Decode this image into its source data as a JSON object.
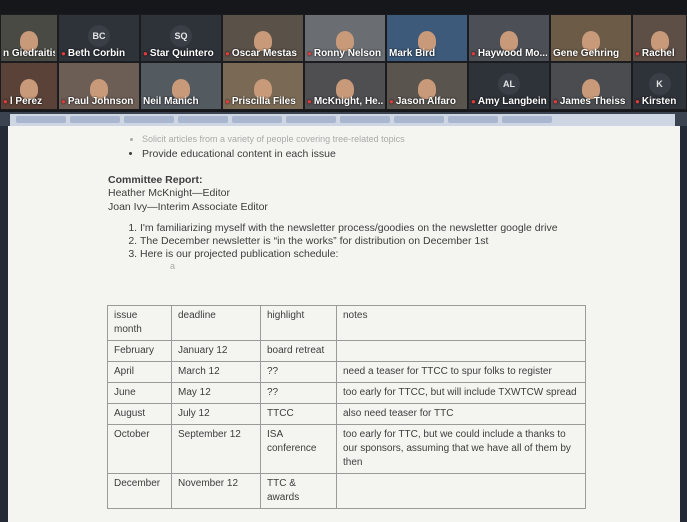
{
  "participants": [
    {
      "name": "n Giedraitis",
      "initials": "",
      "video": true,
      "muted": false
    },
    {
      "name": "Beth Corbin",
      "initials": "BC",
      "video": false,
      "muted": true
    },
    {
      "name": "Star Quintero",
      "initials": "SQ",
      "video": false,
      "muted": true
    },
    {
      "name": "Oscar Mestas",
      "initials": "",
      "video": true,
      "muted": true
    },
    {
      "name": "Ronny Nelson",
      "initials": "",
      "video": true,
      "muted": true
    },
    {
      "name": "Mark Bird",
      "initials": "",
      "video": true,
      "muted": false
    },
    {
      "name": "Haywood Mo...",
      "initials": "",
      "video": true,
      "muted": true
    },
    {
      "name": "Gene Gehring",
      "initials": "",
      "video": true,
      "muted": false
    },
    {
      "name": "Rachel",
      "initials": "",
      "video": true,
      "muted": true
    },
    {
      "name": "l Perez",
      "initials": "",
      "video": true,
      "muted": true
    },
    {
      "name": "Paul Johnson",
      "initials": "",
      "video": true,
      "muted": true
    },
    {
      "name": "Neil Manich",
      "initials": "",
      "video": true,
      "muted": false
    },
    {
      "name": "Priscilla Files",
      "initials": "",
      "video": true,
      "muted": true
    },
    {
      "name": "McKnight, He...",
      "initials": "",
      "video": true,
      "muted": true
    },
    {
      "name": "Jason Alfaro",
      "initials": "",
      "video": true,
      "muted": true
    },
    {
      "name": "Amy Langbein",
      "initials": "AL",
      "video": false,
      "muted": true
    },
    {
      "name": "James Theiss",
      "initials": "",
      "video": true,
      "muted": true
    },
    {
      "name": "Kirsten",
      "initials": "K",
      "video": false,
      "muted": true
    }
  ],
  "doc": {
    "cut_bullet": "Solicit articles from a variety of people covering tree-related topics",
    "bullet": "Provide educational content in each issue",
    "section_title": "Committee Report:",
    "editor": "Heather McKnight—Editor",
    "assoc": "Joan Ivy—Interim Associate Editor",
    "items": [
      "I'm familiarizing myself with the newsletter process/goodies on the newsletter google drive",
      "The December newsletter is “in the works” for distribution on December 1st",
      "Here is our projected publication schedule:"
    ],
    "marker": "a"
  },
  "table": {
    "headers": [
      "issue month",
      "deadline",
      "highlight",
      "notes"
    ],
    "rows": [
      [
        "February",
        "January 12",
        "board retreat",
        ""
      ],
      [
        "April",
        "March 12",
        "??",
        "need a teaser for TTCC to spur folks to register"
      ],
      [
        "June",
        "May 12",
        "??",
        "too early for TTCC, but will include TXWTCW spread"
      ],
      [
        "August",
        "July 12",
        "TTCC",
        "also need teaser for TTC"
      ],
      [
        "October",
        "September 12",
        "ISA conference",
        "too early for TTC, but we could include a thanks to our sponsors, assuming that we have all of them by then"
      ],
      [
        "December",
        "November 12",
        "TTC & awards",
        ""
      ]
    ]
  }
}
